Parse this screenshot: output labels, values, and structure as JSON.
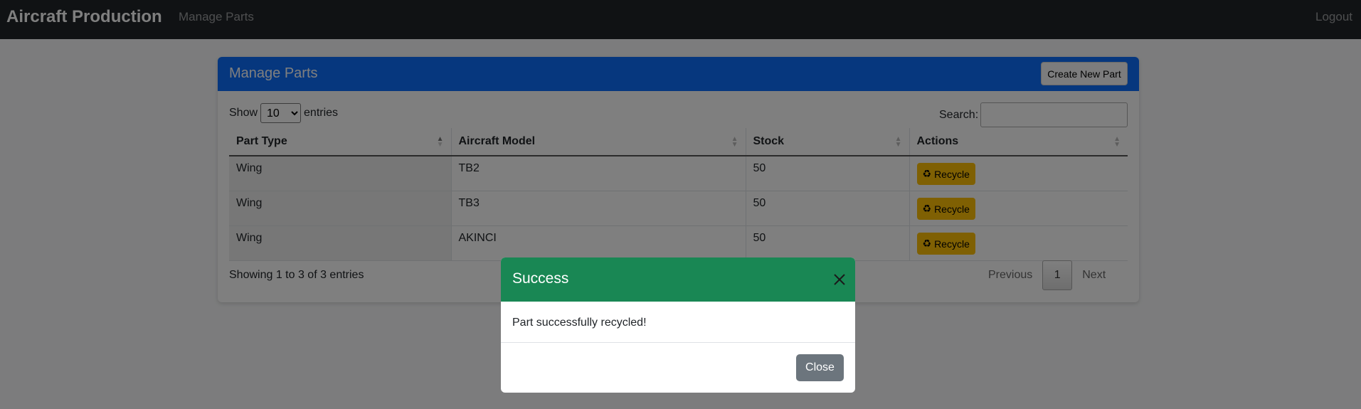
{
  "navbar": {
    "brand": "Aircraft Production",
    "link": "Manage Parts",
    "logout": "Logout"
  },
  "card": {
    "title": "Manage Parts",
    "create_button": "Create New Part",
    "show_label": "Show",
    "entries_value": "10",
    "entries_label": "entries",
    "search_label": "Search:",
    "search_value": ""
  },
  "table": {
    "headers": [
      "Part Type",
      "Aircraft Model",
      "Stock",
      "Actions"
    ],
    "rows": [
      {
        "part_type": "Wing",
        "model": "TB2",
        "stock": "50",
        "action": "Recycle"
      },
      {
        "part_type": "Wing",
        "model": "TB3",
        "stock": "50",
        "action": "Recycle"
      },
      {
        "part_type": "Wing",
        "model": "AKINCI",
        "stock": "50",
        "action": "Recycle"
      }
    ]
  },
  "footer": {
    "info": "Showing 1 to 3 of 3 entries",
    "previous": "Previous",
    "current_page": "1",
    "next": "Next"
  },
  "modal": {
    "title": "Success",
    "message": "Part successfully recycled!",
    "close_button": "Close"
  },
  "colors": {
    "navbar": "#212529",
    "card_header": "#0d6efd",
    "recycle_button": "#ffc107",
    "modal_header": "#198754",
    "close_button": "#6c757d"
  },
  "icons": {
    "recycle": "recycle-icon",
    "modal_close": "close-icon",
    "sort": "sort-icon"
  }
}
